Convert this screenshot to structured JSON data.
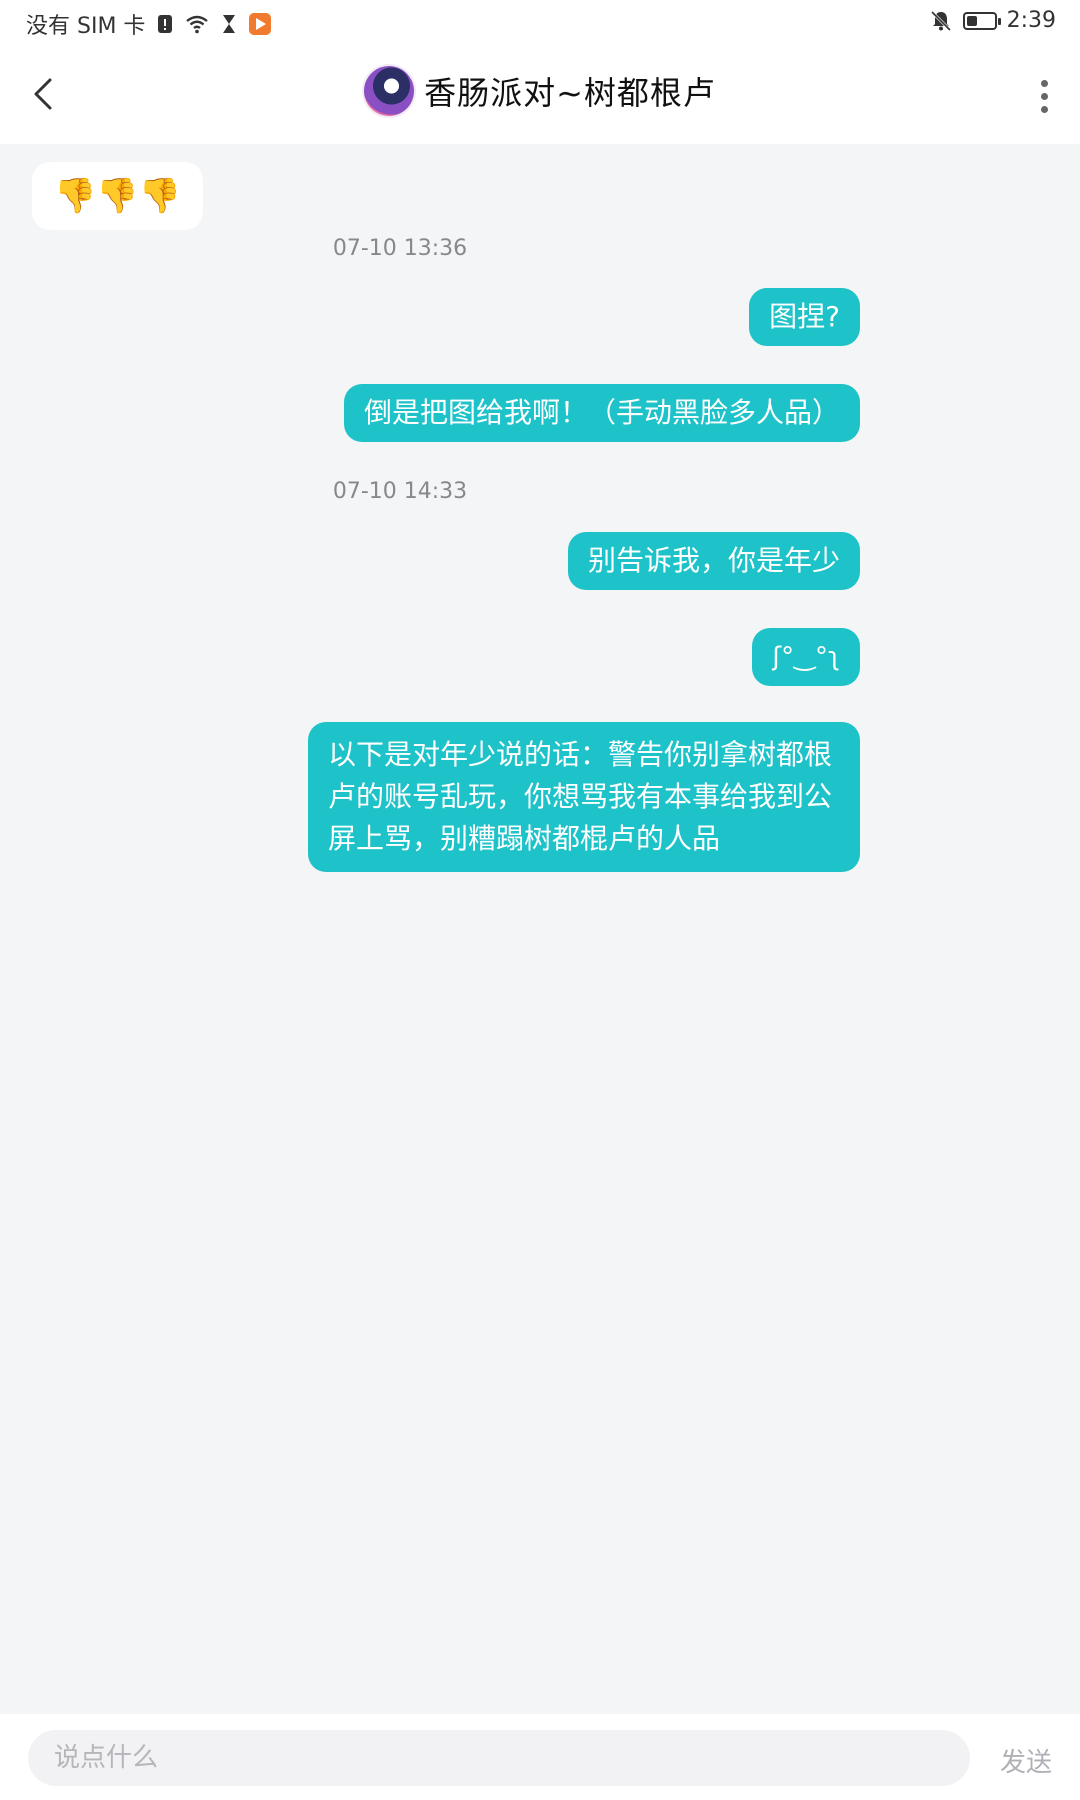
{
  "status_bar": {
    "carrier": "没有 SIM 卡",
    "time": "2:39",
    "battery_level": 0.4,
    "icons": [
      "sim-alert-icon",
      "wifi-icon",
      "hourglass-icon",
      "video-app-icon",
      "bell-off-icon",
      "battery-icon"
    ]
  },
  "header": {
    "title": "香肠派对~树都根卢",
    "back_icon": "chevron-left-icon",
    "more_icon": "more-vertical-icon"
  },
  "messages": [
    {
      "type": "in",
      "text": "👎👎👎"
    },
    {
      "type": "timestamp",
      "text": "07-10 13:36"
    },
    {
      "type": "out",
      "text": "图捏?"
    },
    {
      "type": "out",
      "text": "倒是把图给我啊！（手动黑脸多人品）"
    },
    {
      "type": "timestamp",
      "text": "07-10 14:33"
    },
    {
      "type": "out",
      "text": "别告诉我，你是年少"
    },
    {
      "type": "out",
      "text": "ʃ°‿°ʅ"
    },
    {
      "type": "out",
      "text": "以下是对年少说的话：警告你别拿树都根卢的账号乱玩，你想骂我有本事给我到公屏上骂，别糟蹋树都棍卢的人品"
    }
  ],
  "input": {
    "placeholder": "说点什么",
    "value": "",
    "send_label": "发送"
  },
  "colors": {
    "outgoing_bubble": "#1ec2c9",
    "background": "#f4f5f7"
  }
}
